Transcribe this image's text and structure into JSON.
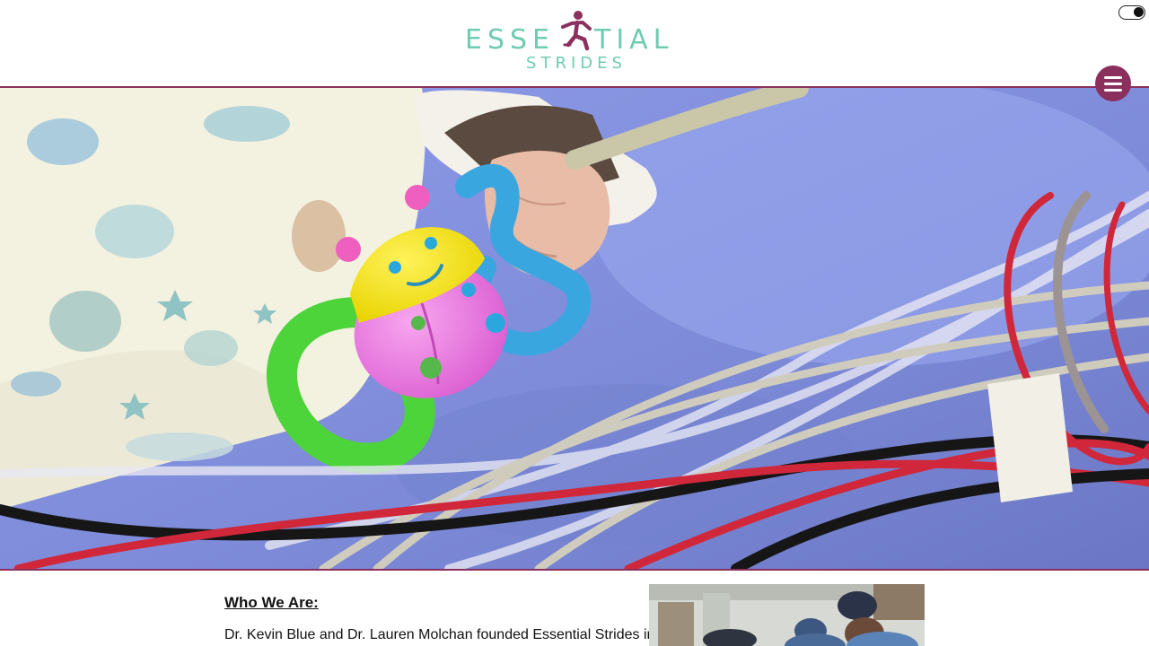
{
  "header": {
    "logo_line1": "ESSE",
    "logo_line1_end": "TIAL",
    "logo_line2": "STRIDES",
    "logo_color": "#6fcbb1",
    "logo_runner_color": "#8b2f5c",
    "theme_toggle": {
      "icon": "toggle-icon",
      "state": "on"
    },
    "menu_button": {
      "icon": "hamburger-icon",
      "color": "#8b2f5c"
    }
  },
  "hero": {
    "image_description": "Infant's hand holding a colourful ladybug teether on a blue hospital blanket with medical tubing"
  },
  "about": {
    "heading": "Who We Are:",
    "paragraph": "Dr. Kevin Blue and Dr. Lauren Molchan founded Essential Strides in"
  },
  "colors": {
    "accent": "#8b2f5c",
    "brand_teal": "#6fcbb1"
  }
}
